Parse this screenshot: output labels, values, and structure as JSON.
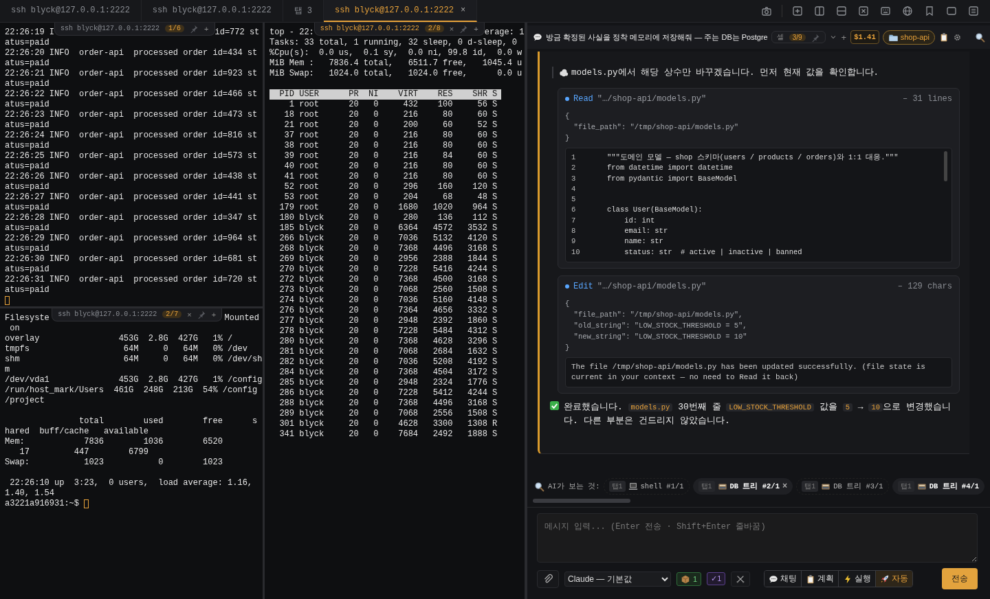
{
  "tabs": [
    {
      "label": "ssh blyck@127.0.0.1:2222",
      "selected": false
    },
    {
      "label": "ssh blyck@127.0.0.1:2222",
      "selected": false
    },
    {
      "label": "탭 3",
      "selected": false
    },
    {
      "label": "ssh blyck@127.0.0.1:2222",
      "selected": true,
      "close": "×"
    }
  ],
  "panes": [
    {
      "first_left": "22:26:19 I",
      "first_right": "id=772 st",
      "header": {
        "title": "ssh blyck@127.0.0.1:2222",
        "badge": "1/6",
        "active": false,
        "add": "+"
      },
      "cursor": true,
      "blocks": [
        [
          "atus=paid",
          "22:26:20 INFO  order-api  processed order id=434 st",
          "atus=paid",
          "22:26:21 INFO  order-api  processed order id=923 st",
          "atus=paid",
          "22:26:22 INFO  order-api  processed order id=466 st",
          "atus=paid",
          "22:26:23 INFO  order-api  processed order id=473 st",
          "atus=paid",
          "22:26:24 INFO  order-api  processed order id=816 st",
          "atus=paid",
          "22:26:25 INFO  order-api  processed order id=573 st",
          "atus=paid",
          "22:26:26 INFO  order-api  processed order id=438 st",
          "atus=paid",
          "22:26:27 INFO  order-api  processed order id=441 st",
          "atus=paid",
          "22:26:28 INFO  order-api  processed order id=347 st",
          "atus=paid",
          "22:26:29 INFO  order-api  processed order id=964 st",
          "atus=paid",
          "22:26:30 INFO  order-api  processed order id=681 st",
          "atus=paid",
          "22:26:31 INFO  order-api  processed order id=720 st",
          "atus=paid"
        ]
      ]
    },
    {
      "first_left": "Filesyste",
      "first_right": "Mounted",
      "header": {
        "title": "ssh blyck@127.0.0.1:2222",
        "badge": "2/7",
        "active": false,
        "close": "×",
        "add": "+"
      },
      "cursor": true,
      "prompt": "a3221a916931:~$",
      "blocks": [
        [
          " on",
          "overlay                453G  2.8G  427G   1% /",
          "tmpfs                   64M     0   64M   0% /dev",
          "shm                     64M     0   64M   0% /dev/sh",
          "m",
          "/dev/vda1              453G  2.8G  427G   1% /config",
          "/run/host_mark/Users  461G  248G  213G  54% /config",
          "/project"
        ],
        [
          "               total        used        free      s",
          "hared  buff/cache   available",
          "Mem:            7836        1036        6520",
          "   17         447        6799",
          "Swap:           1023           0        1023"
        ],
        [
          " 22:26:10 up  3:23,  0 users,  load average: 1.16,",
          "1.40, 1.54"
        ]
      ]
    }
  ],
  "top": {
    "first_left": "top - 22:",
    "first_right": "erage: 1",
    "header": {
      "title": "ssh blyck@127.0.0.1:2222",
      "badge": "2/8",
      "active": true,
      "close": "×",
      "add": "+"
    },
    "lines": [
      "Tasks: 33 total, 1 running, 32 sleep, 0 d-sleep, 0",
      "%Cpu(s):  0.0 us,  0.1 sy,  0.0 ni, 99.8 id,  0.0 w",
      "MiB Mem :   7836.4 total,   6511.7 free,   1045.4 u",
      "MiB Swap:   1024.0 total,   1024.0 free,      0.0 u"
    ],
    "table_header": "  PID USER      PR  NI    VIRT    RES    SHR S",
    "rows": [
      "    1 root      20   0     432    100     56 S",
      "   18 root      20   0     216     80     60 S",
      "   21 root      20   0     200     60     52 S",
      "   37 root      20   0     216     80     60 S",
      "   38 root      20   0     216     80     60 S",
      "   39 root      20   0     216     84     60 S",
      "   40 root      20   0     216     80     60 S",
      "   41 root      20   0     216     80     60 S",
      "   52 root      20   0     296    160    120 S",
      "   53 root      20   0     204     68     48 S",
      "  179 root      20   0    1680   1020    964 S",
      "  180 blyck     20   0     280    136    112 S",
      "  185 blyck     20   0    6364   4572   3532 S",
      "  266 blyck     20   0    7036   5132   4120 S",
      "  268 blyck     20   0    7368   4496   3168 S",
      "  269 blyck     20   0    2956   2388   1844 S",
      "  270 blyck     20   0    7228   5416   4244 S",
      "  272 blyck     20   0    7368   4500   3168 S",
      "  273 blyck     20   0    7068   2560   1508 S",
      "  274 blyck     20   0    7036   5160   4148 S",
      "  276 blyck     20   0    7364   4656   3332 S",
      "  277 blyck     20   0    2948   2392   1860 S",
      "  278 blyck     20   0    7228   5484   4312 S",
      "  280 blyck     20   0    7368   4628   3296 S",
      "  281 blyck     20   0    7068   2684   1632 S",
      "  282 blyck     20   0    7036   5208   4192 S",
      "  284 blyck     20   0    7368   4504   3172 S",
      "  285 blyck     20   0    2948   2324   1776 S",
      "  286 blyck     20   0    7228   5412   4244 S",
      "  288 blyck     20   0    7368   4496   3168 S",
      "  289 blyck     20   0    7068   2556   1508 S",
      "  301 blyck     20   0    4628   3300   1308 R",
      "  341 blyck     20   0    7684   2492   1888 S"
    ]
  },
  "chat": {
    "title": "방금 확정된 사실을 정착 메모리에 저장해줘 — 주는 DB는 Postgre",
    "cell": {
      "label": "셀",
      "badge": "3/9"
    },
    "add": "+",
    "cost": "$1.41",
    "project": "shop-api",
    "thinking": "models.py에서 해당 상수만 바꾸겠습니다. 먼저 현재 값을 확인합니다.",
    "tools": [
      {
        "name": "Read",
        "path": "\"…/shop-api/models.py\"",
        "meta": "– 31 lines",
        "input": [
          "{",
          "  \"file_path\": \"/tmp/shop-api/models.py\"",
          "}"
        ],
        "output": {
          "kind": "code",
          "lines": [
            {
              "n": "1",
              "code": "\"\"\"도메인 모델 — shop 스키마(users / products / orders)와 1:1 대응.\"\"\""
            },
            {
              "n": "2",
              "code": "from datetime import datetime"
            },
            {
              "n": "3",
              "code": "from pydantic import BaseModel"
            },
            {
              "n": "4"
            },
            {
              "n": "5"
            },
            {
              "n": "6",
              "code": "class User(BaseModel):"
            },
            {
              "n": "7",
              "code": "    id: int"
            },
            {
              "n": "8",
              "code": "    email: str"
            },
            {
              "n": "9",
              "code": "    name: str"
            },
            {
              "n": "10",
              "code": "    status: str  # active | inactive | banned"
            }
          ]
        }
      },
      {
        "name": "Edit",
        "path": "\"…/shop-api/models.py\"",
        "meta": "– 129 chars",
        "input": [
          "{",
          "  \"file_path\": \"/tmp/shop-api/models.py\",",
          "  \"old_string\": \"LOW_STOCK_THRESHOLD = 5\",",
          "  \"new_string\": \"LOW_STOCK_THRESHOLD = 10\"",
          "}"
        ],
        "output": {
          "kind": "text",
          "text": "The file /tmp/shop-api/models.py has been updated successfully. (file state is current in your context — no need to Read it back)"
        }
      }
    ],
    "final": [
      {
        "text": "완료했습니다. ",
        "code": false
      },
      {
        "text": "models.py",
        "code": true
      },
      {
        "text": " 30번째 줄 ",
        "code": false
      },
      {
        "text": "LOW_STOCK_THRESHOLD",
        "code": true
      },
      {
        "text": " 값을 ",
        "code": false
      },
      {
        "text": "5",
        "code": true
      },
      {
        "text": " → ",
        "code": false
      },
      {
        "text": "10",
        "code": true
      },
      {
        "text": "으로 변경했습니다. 다른 부분은 건드리지 않았습니다.",
        "code": false
      }
    ],
    "context_label": "AI가 보는 것:",
    "context": [
      {
        "tag": "탭1",
        "kind": "shell",
        "label": "shell #1/1",
        "selected": false
      },
      {
        "tag": "탭1",
        "kind": "tree",
        "label": "DB 트리 #2/1",
        "selected": true,
        "close": "×"
      },
      {
        "tag": "탭1",
        "kind": "tree",
        "label": "DB 트리 #3/1",
        "selected": false
      },
      {
        "tag": "탭1",
        "kind": "tree",
        "label": "DB 트리 #4/1",
        "selected": true
      }
    ],
    "placeholder": "메시지 입력... (Enter 전송 · Shift+Enter 줄바꿈)",
    "model": "Claude — 기본값",
    "box_count": "1",
    "check_count": "✓1",
    "modes": [
      {
        "label": "채팅",
        "selected": false
      },
      {
        "label": "계획",
        "selected": false
      },
      {
        "label": "실행",
        "selected": false
      },
      {
        "label": "자동",
        "selected": true
      }
    ],
    "send": "전송"
  }
}
